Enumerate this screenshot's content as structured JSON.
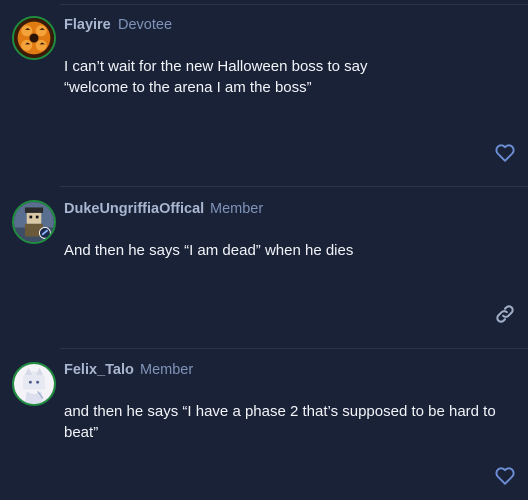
{
  "posts": [
    {
      "username": "Flayire",
      "user_title": "Devotee",
      "body_lines": [
        "I can’t wait for the new Halloween boss to say",
        "“welcome to the arena I am the boss”"
      ],
      "action_icon": "heart-icon"
    },
    {
      "username": "DukeUngriffiaOffical",
      "user_title": "Member",
      "body_lines": [
        "And then he says “I am dead” when he dies"
      ],
      "action_icon": "link-icon"
    },
    {
      "username": "Felix_Talo",
      "user_title": "Member",
      "body_lines": [
        "and then he says “I have a phase 2 that’s supposed to be hard to beat”"
      ],
      "action_icon": "heart-icon"
    }
  ],
  "colors": {
    "background": "#1a2238",
    "username": "#a8b6cf",
    "user_title": "#7f93b8",
    "body_text": "#f2f4f8",
    "action_icon": "#6d8fd6",
    "avatar_ring": "#1f8f3f"
  }
}
